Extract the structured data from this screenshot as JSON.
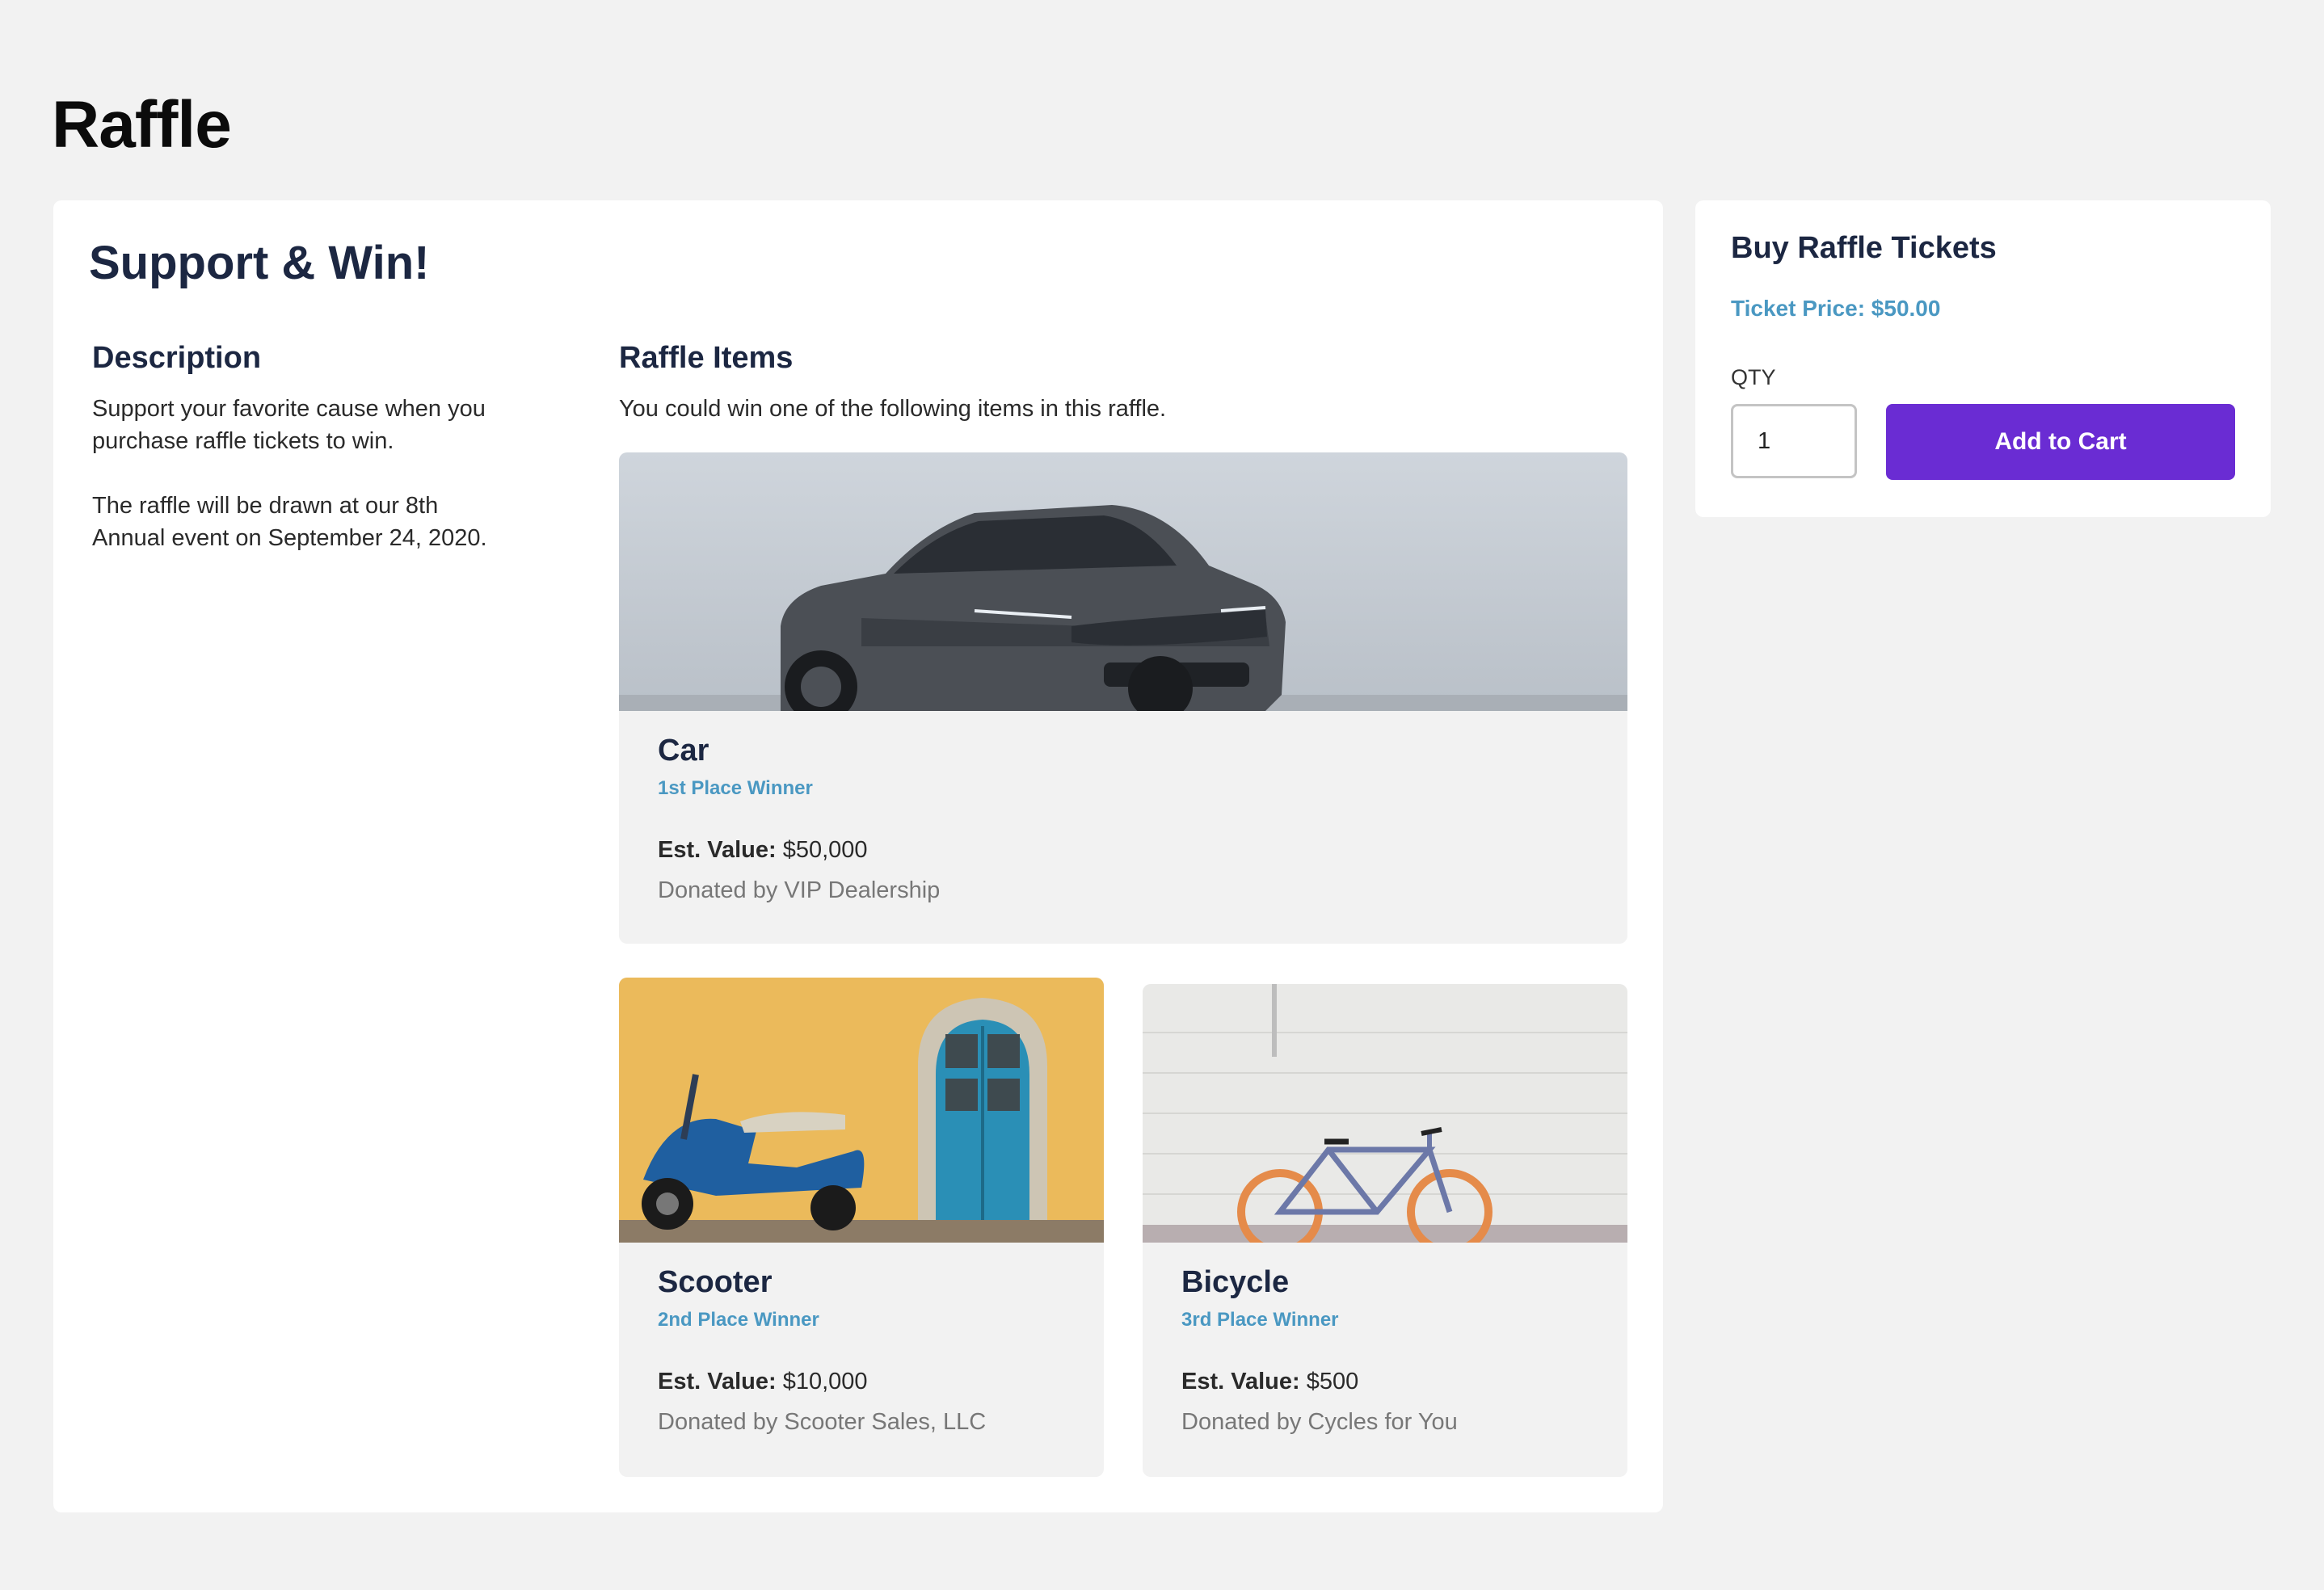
{
  "page": {
    "title": "Raffle"
  },
  "main": {
    "heading": "Support & Win!",
    "description": {
      "heading": "Description",
      "line1": "Support your favorite cause when you",
      "line2": "purchase raffle tickets to win.",
      "line3": "The raffle will be drawn at our 8th",
      "line4": "Annual event on September 24, 2020."
    },
    "items_section": {
      "heading": "Raffle Items",
      "intro": "You could win one of the following items in this raffle.",
      "est_value_label": "Est. Value:",
      "items": [
        {
          "name": "Car",
          "place": "1st Place Winner",
          "value": "$50,000",
          "donor": "Donated by VIP Dealership",
          "image": "car-photo"
        },
        {
          "name": "Scooter",
          "place": "2nd Place Winner",
          "value": "$10,000",
          "donor": "Donated by Scooter Sales, LLC",
          "image": "scooter-photo"
        },
        {
          "name": "Bicycle",
          "place": "3rd Place Winner",
          "value": "$500",
          "donor": "Donated by Cycles for You",
          "image": "bicycle-photo"
        }
      ]
    }
  },
  "sidebar": {
    "heading": "Buy Raffle Tickets",
    "price": "Ticket Price: $50.00",
    "qty_label": "QTY",
    "qty_value": "1",
    "add_button": "Add to Cart"
  },
  "colors": {
    "accent": "#6a2cd3",
    "link": "#4a98c2",
    "heading": "#1c2742",
    "background": "#f2f2f2"
  }
}
